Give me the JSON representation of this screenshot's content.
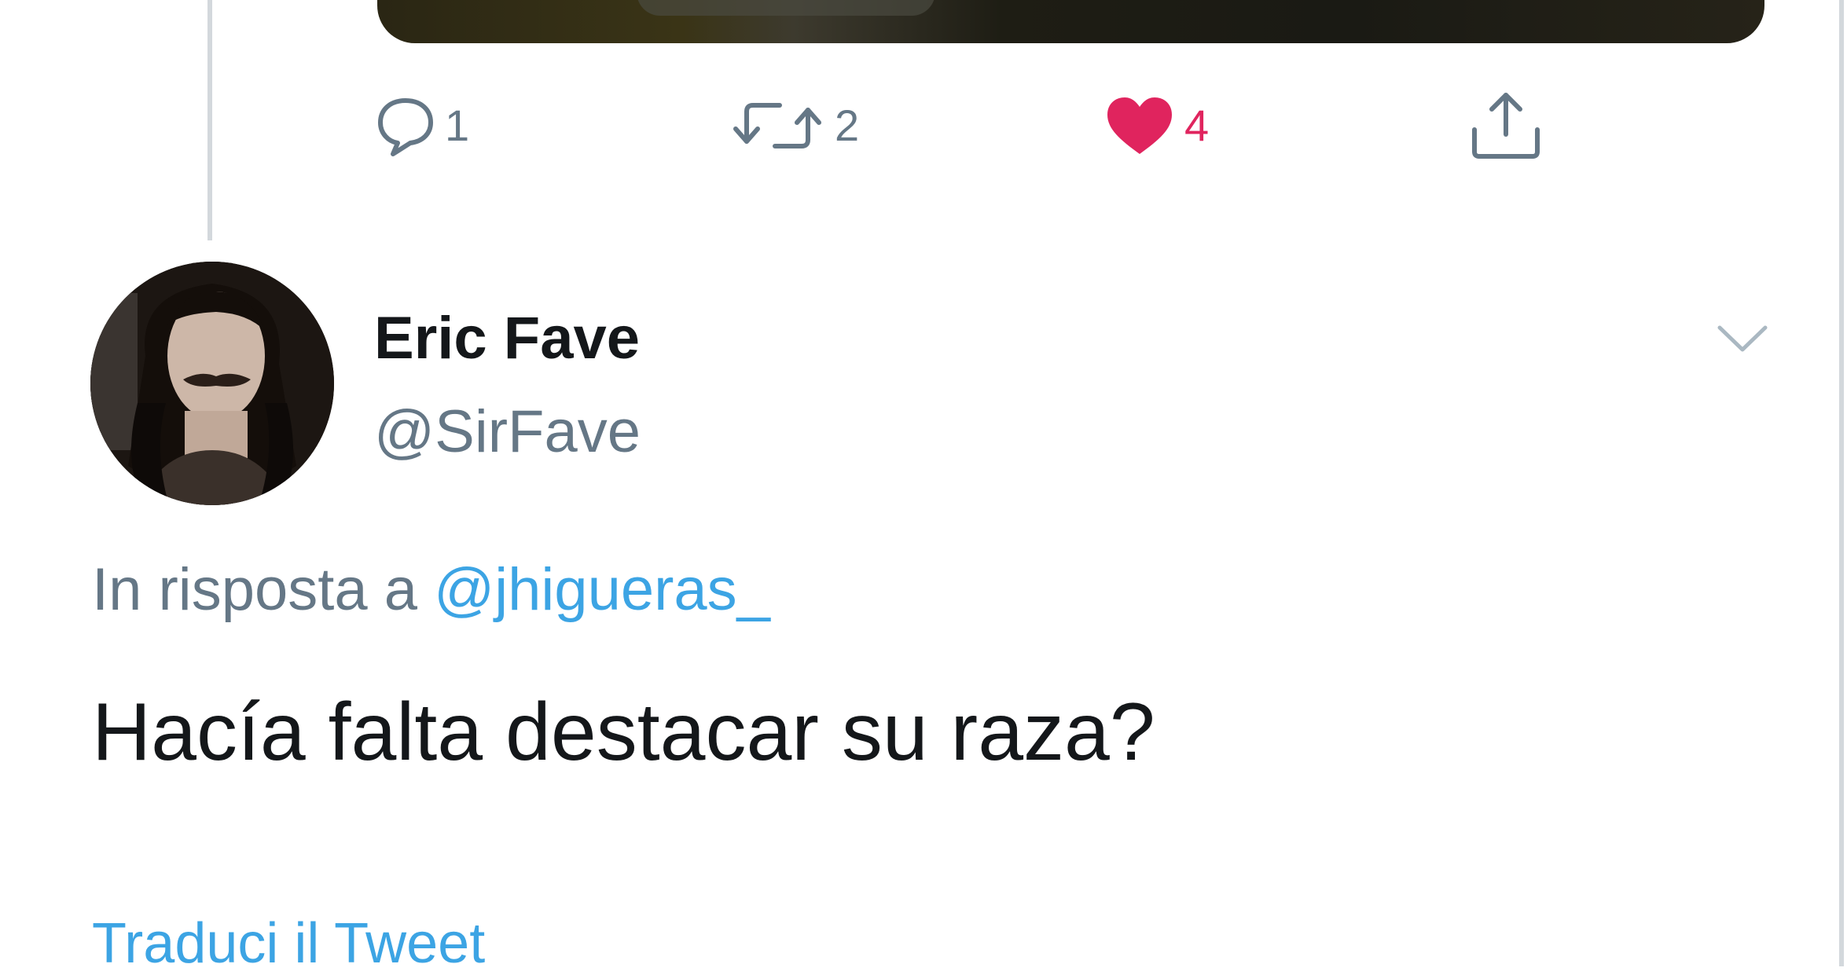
{
  "colors": {
    "text_primary": "#14171a",
    "text_secondary": "#657786",
    "link": "#1b95e0",
    "like": "#e0245e",
    "border": "#d3d8dc"
  },
  "parent_tweet": {
    "actions": {
      "reply": {
        "icon": "reply-icon",
        "count": "1"
      },
      "retweet": {
        "icon": "retweet-icon",
        "count": "2"
      },
      "like": {
        "icon": "heart-icon",
        "count": "4",
        "liked": true
      },
      "share": {
        "icon": "share-icon"
      }
    }
  },
  "tweet": {
    "author": {
      "display_name": "Eric Fave",
      "handle": "@SirFave",
      "avatar_icon": "avatar"
    },
    "menu_icon": "chevron-down-icon",
    "reply_context": {
      "prefix": "In risposta a ",
      "mention": "@jhigueras_"
    },
    "text": "Hacía falta destacar su raza?",
    "translate_label": "Traduci il Tweet"
  }
}
